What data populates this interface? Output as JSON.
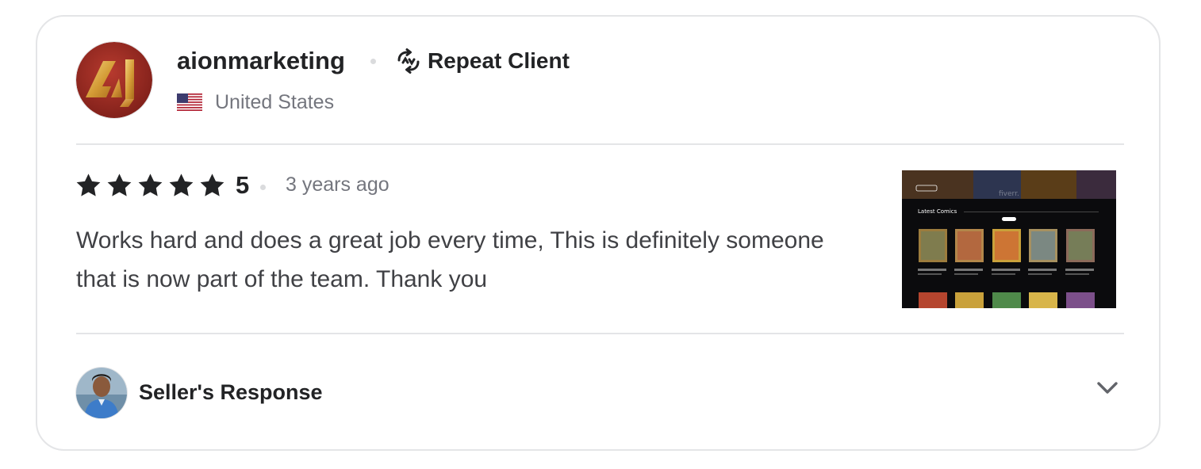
{
  "review": {
    "username": "aionmarketing",
    "badge_label": "Repeat Client",
    "country": "United States",
    "rating_value": "5",
    "stars": 5,
    "time_ago": "3 years ago",
    "text": "Works hard and does a great job every time, This is definitely someone that is now part of the team. Thank you",
    "thumbnail": {
      "section_title": "Latest Comics",
      "watermark": "fiverr."
    }
  },
  "seller_response": {
    "label": "Seller's Response",
    "toggle_icon": "chevron-down-icon"
  },
  "icons": {
    "repeat": "repeat-icon",
    "flag": "us-flag-icon",
    "star": "star-icon"
  },
  "colors": {
    "text_primary": "#222325",
    "text_secondary": "#74767e",
    "text_body": "#404145",
    "border": "#e4e5e7",
    "avatar_red": "#9b2b22",
    "avatar_gold": "#d9a441"
  }
}
